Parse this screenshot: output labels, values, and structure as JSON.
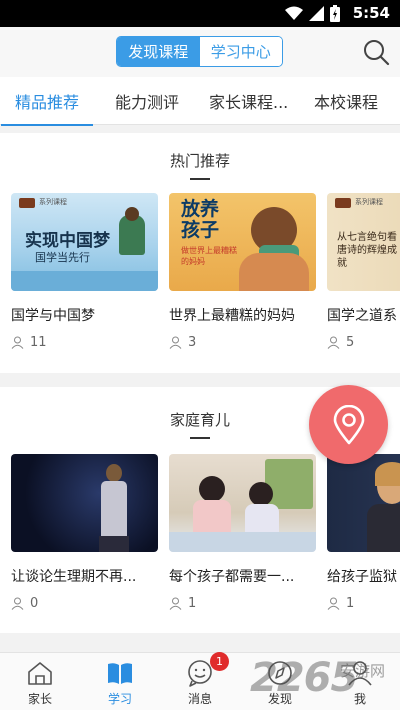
{
  "status": {
    "time": "5:54"
  },
  "header": {
    "segment": [
      "发现课程",
      "学习中心"
    ]
  },
  "tabs": [
    "精品推荐",
    "能力测评",
    "家长课程...",
    "本校课程"
  ],
  "sections": [
    {
      "title": "热门推荐",
      "cards": [
        {
          "title": "国学与中国梦",
          "count": "11",
          "thumb_title": "实现中国梦",
          "thumb_sub": "国学当先行",
          "thumb_tag": "系列课程"
        },
        {
          "title": "世界上最糟糕的妈妈",
          "count": "3",
          "thumb_title": "放养孩子",
          "thumb_sub": "做世界上最糟糕的妈妈"
        },
        {
          "title": "国学之道系",
          "count": "5",
          "thumb_title": "从七言绝句看唐诗的辉煌成就",
          "thumb_tag": "系列课程"
        }
      ]
    },
    {
      "title": "家庭育儿",
      "cards": [
        {
          "title": "让谈论生理期不再...",
          "count": "0"
        },
        {
          "title": "每个孩子都需要一...",
          "count": "1"
        },
        {
          "title": "给孩子监狱",
          "count": "1"
        }
      ]
    }
  ],
  "nav": [
    {
      "label": "家长",
      "icon": "home-icon"
    },
    {
      "label": "学习",
      "icon": "book-icon"
    },
    {
      "label": "消息",
      "icon": "message-icon",
      "badge": "1"
    },
    {
      "label": "发现",
      "icon": "compass-icon"
    },
    {
      "label": "我",
      "icon": "user-icon"
    }
  ],
  "watermark": {
    "main": "2265",
    "sub": "安游网"
  },
  "colors": {
    "accent": "#2a8de0",
    "fab": "#f06a6c",
    "badge": "#e02b2b"
  }
}
